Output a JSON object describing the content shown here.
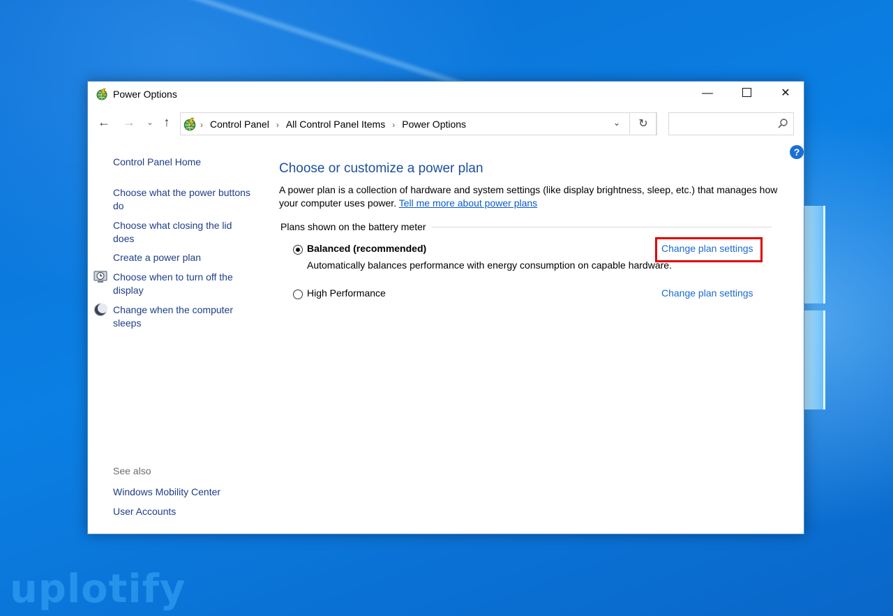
{
  "window": {
    "title": "Power Options",
    "controls": {
      "minimize": "—",
      "close": "✕"
    }
  },
  "nav": {
    "back": "←",
    "forward": "→",
    "recent": "⌄",
    "up": "↑",
    "breadcrumbs": [
      "Control Panel",
      "All Control Panel Items",
      "Power Options"
    ],
    "separator": "›",
    "dropdown": "⌄",
    "refresh": "↻",
    "search_placeholder": ""
  },
  "help_label": "?",
  "sidebar": {
    "home": "Control Panel Home",
    "links": [
      "Choose what the power buttons do",
      "Choose what closing the lid does",
      "Create a power plan",
      "Choose when to turn off the display",
      "Change when the computer sleeps"
    ],
    "see_also_label": "See also",
    "see_also": [
      "Windows Mobility Center",
      "User Accounts"
    ]
  },
  "main": {
    "heading": "Choose or customize a power plan",
    "description": "A power plan is a collection of hardware and system settings (like display brightness, sleep, etc.) that manages how your computer uses power.",
    "learn_more_link": "Tell me more about power plans",
    "group_label": "Plans shown on the battery meter",
    "plans": [
      {
        "name": "Balanced (recommended)",
        "selected": true,
        "description": "Automatically balances performance with energy consumption on capable hardware.",
        "link": "Change plan settings"
      },
      {
        "name": "High Performance",
        "selected": false,
        "description": "",
        "link": "Change plan settings"
      }
    ]
  },
  "watermark": "uplotify",
  "colors": {
    "link": "#1e3d87",
    "heading": "#1d4f9c",
    "highlight": "#e00000",
    "desktop": "#0a74d6"
  }
}
